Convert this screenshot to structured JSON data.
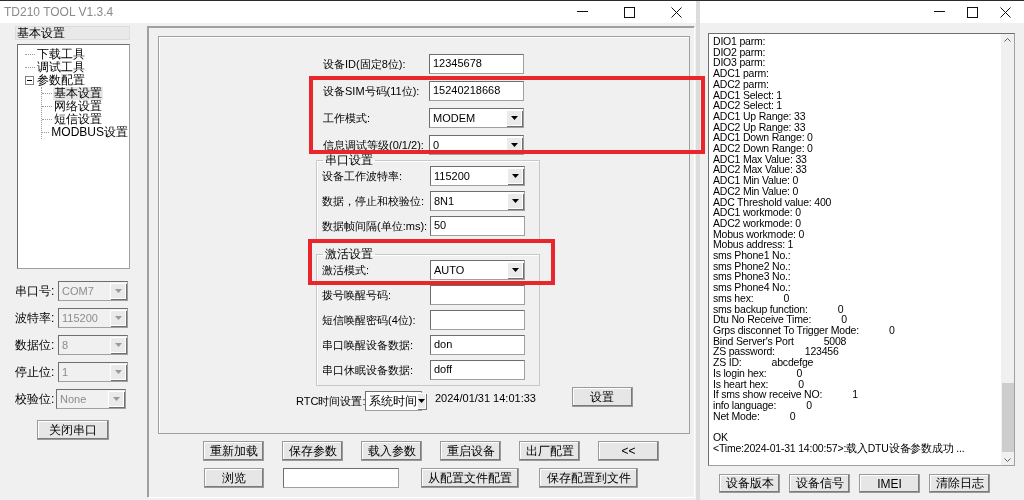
{
  "main_window": {
    "title": "TD210 TOOL V1.3.4",
    "sidebar": {
      "header": "基本设置",
      "tree": [
        {
          "label": "下载工具",
          "selected": false
        },
        {
          "label": "调试工具",
          "selected": false
        },
        {
          "label": "参数配置",
          "selected": false,
          "expanded": true,
          "children": [
            {
              "label": "基本设置",
              "selected": true
            },
            {
              "label": "网络设置",
              "selected": false
            },
            {
              "label": "短信设置",
              "selected": false
            },
            {
              "label": "MODBUS设置",
              "selected": false
            }
          ]
        }
      ]
    },
    "serial_port": {
      "fields": [
        {
          "label": "串口号:",
          "value": "COM7",
          "disabled": true
        },
        {
          "label": "波特率:",
          "value": "115200",
          "disabled": true
        },
        {
          "label": "数据位:",
          "value": "8",
          "disabled": true
        },
        {
          "label": "停止位:",
          "value": "1",
          "disabled": true
        },
        {
          "label": "校验位:",
          "value": "None",
          "disabled": true
        }
      ],
      "button": "关闭串口"
    },
    "form": {
      "rows": [
        {
          "kind": "input",
          "label": "设备ID(固定8位):",
          "value": "12345678",
          "highlighted": false
        },
        {
          "kind": "input",
          "label": "设备SIM号码(11位):",
          "value": "15240218668",
          "highlighted": true
        },
        {
          "kind": "combo",
          "label": "工作模式:",
          "value": "MODEM",
          "highlighted": true
        },
        {
          "kind": "combo",
          "label": "信息调试等级(0/1/2):",
          "value": "0",
          "highlighted": true
        }
      ],
      "groups": [
        {
          "title": "串口设置",
          "highlighted": false,
          "rows": [
            {
              "kind": "combo",
              "label": "设备工作波特率:",
              "value": "115200",
              "highlighted": false
            },
            {
              "kind": "combo",
              "label": "数据，停止和校验位:",
              "value": "8N1",
              "highlighted": false
            },
            {
              "kind": "input",
              "label": "数据帧间隔(单位:ms):",
              "value": "50",
              "highlighted": false
            }
          ]
        },
        {
          "title": "激活设置",
          "highlighted": true,
          "rows": [
            {
              "kind": "combo",
              "label": "激活模式:",
              "value": "AUTO",
              "highlighted": true
            },
            {
              "kind": "input",
              "label": "拨号唤醒号码:",
              "highlighted": false
            },
            {
              "kind": "input",
              "label": "短信唤醒密码(4位):",
              "highlighted": false
            },
            {
              "kind": "input",
              "label": "串口唤醒设备数据:",
              "value": "don",
              "highlighted": false
            },
            {
              "kind": "input",
              "label": "串口休眠设备数据:",
              "value": "doff",
              "highlighted": false
            }
          ]
        }
      ],
      "rtc": {
        "label": "RTC时间设置:",
        "mode": "系统时间",
        "time": "2024/01/31 14:01:33",
        "button": "设置"
      }
    },
    "button_rows": [
      [
        {
          "kind": "button",
          "label": "重新加载"
        },
        {
          "kind": "button",
          "label": "保存参数"
        },
        {
          "kind": "button",
          "label": "载入参数"
        },
        {
          "kind": "button",
          "label": "重启设备"
        },
        {
          "kind": "button",
          "label": "出厂配置"
        },
        {
          "kind": "button",
          "label": "<<"
        }
      ],
      [
        {
          "kind": "button",
          "label": "浏览"
        },
        {
          "kind": "field"
        },
        {
          "kind": "button",
          "label": "从配置文件配置"
        },
        {
          "kind": "button",
          "label": "保存配置到文件"
        }
      ]
    ]
  },
  "log_window": {
    "lines": [
      {
        "text": "DIO1 parm:"
      },
      {
        "text": "DIO2 parm:"
      },
      {
        "text": "DIO3 parm:"
      },
      {
        "text": "ADC1 parm:"
      },
      {
        "text": "ADC2 parm:"
      },
      {
        "text": "ADC1 Select: 1"
      },
      {
        "text": "ADC2 Select: 1"
      },
      {
        "text": "ADC1 Up Range: 33"
      },
      {
        "text": "ADC2 Up Range: 33"
      },
      {
        "text": "ADC1 Down Range: 0"
      },
      {
        "text": "ADC2 Down Range: 0"
      },
      {
        "text": "ADC1 Max Value: 33"
      },
      {
        "text": "ADC2 Max Value: 33"
      },
      {
        "text": "ADC1 Min Value: 0"
      },
      {
        "text": "ADC2 Min Value: 0"
      },
      {
        "text": "ADC Threshold value: 400"
      },
      {
        "text": "ADC1 workmode: 0"
      },
      {
        "text": "ADC2 workmode: 0"
      },
      {
        "text": "Mobus workmode: 0"
      },
      {
        "text": "Mobus address: 1"
      },
      {
        "text": "sms Phone1 No.:"
      },
      {
        "text": "sms Phone2 No.:"
      },
      {
        "text": "sms Phone3 No.:"
      },
      {
        "text": "sms Phone4 No.:"
      },
      {
        "text": "sms hex:",
        "value": "0"
      },
      {
        "text": "sms backup function:",
        "value": "0"
      },
      {
        "text": "Dtu No Receive Time:",
        "value": "0"
      },
      {
        "text": "Grps disconnet To Trigger Mode:",
        "value": "0"
      },
      {
        "text": "Bind Server's Port",
        "value": "5008"
      },
      {
        "text": "ZS password:",
        "value": "123456"
      },
      {
        "text": "ZS ID:",
        "value": "abcdefge"
      },
      {
        "text": "Is login hex:",
        "value": "0"
      },
      {
        "text": "Is heart hex:",
        "value": "0"
      },
      {
        "text": "If sms show receive NO:",
        "value": "1"
      },
      {
        "text": "info language:",
        "value": "0"
      },
      {
        "text": "Net Mode:",
        "value": "0"
      },
      {
        "text": "OK",
        "spaced": true
      },
      {
        "text": "<Time:2024-01-31 14:00:57>:载入DTU设备参数成功 ..."
      }
    ],
    "buttons": [
      "设备版本",
      "设备信号",
      "IMEI",
      "清除日志"
    ]
  }
}
